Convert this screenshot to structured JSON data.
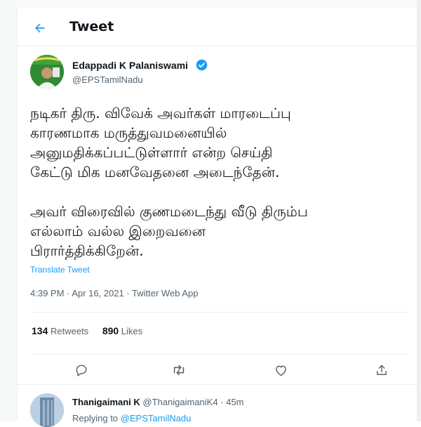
{
  "header": {
    "title": "Tweet"
  },
  "tweet": {
    "author_name": "Edappadi K Palaniswami",
    "author_handle": "@EPSTamilNadu",
    "text": "நடிகர் திரு. விவேக் அவர்கள் மாரடைப்பு\nகாரணமாக மருத்துவமனையில்\nஅனுமதிக்கப்பட்டுள்ளார் என்ற செய்தி\nகேட்டு மிக மனவேதனை அடைந்தேன்.\n\nஅவர் விரைவில் குணமடைந்து வீடு திரும்ப\nஎல்லாம் வல்ல இறைவனை\nபிரார்த்திக்கிறேன்.",
    "translate_label": "Translate Tweet",
    "meta": "4:39 PM · Apr 16, 2021 · Twitter Web App",
    "retweets_count": "134",
    "retweets_label": "Retweets",
    "likes_count": "890",
    "likes_label": "Likes"
  },
  "actions": [
    "reply-icon",
    "retweet-icon",
    "like-icon",
    "share-icon"
  ],
  "reply": {
    "author_name": "Thanigaimani K",
    "author_handle_time": "@ThanigaimaniK4 · 45m",
    "replying_label": "Replying to",
    "replying_to": "@EPSTamilNadu"
  },
  "colors": {
    "accent": "#1d9bf0",
    "verified": "#1d9bf0",
    "muted": "#536471"
  }
}
